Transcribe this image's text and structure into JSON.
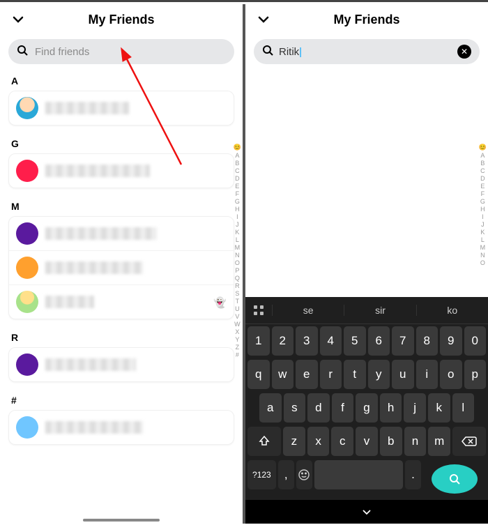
{
  "title": "My Friends",
  "search_placeholder": "Find friends",
  "search_value": "Ritik",
  "sections": {
    "A": "A",
    "G": "G",
    "M": "M",
    "R": "R",
    "hash": "#"
  },
  "avatars": {
    "a1": "#ffb36b",
    "g1": "#ff1e4b",
    "m1": "#5a1a9e",
    "m2": "#ffa02e",
    "m3": "#9ad86a",
    "r1": "#5a1a9e",
    "h1": "#70c6ff"
  },
  "mutual_icon": "👻",
  "az": [
    "😊",
    "A",
    "B",
    "C",
    "D",
    "E",
    "F",
    "G",
    "H",
    "I",
    "J",
    "K",
    "L",
    "M",
    "N",
    "O",
    "P",
    "Q",
    "R",
    "S",
    "T",
    "U",
    "V",
    "W",
    "X",
    "Y",
    "Z",
    "#"
  ],
  "az_right": [
    "😊",
    "A",
    "B",
    "C",
    "D",
    "E",
    "F",
    "G",
    "H",
    "I",
    "J",
    "K",
    "L",
    "M",
    "N",
    "O"
  ],
  "sugg": {
    "s1": "se",
    "s2": "sir",
    "s3": "ko"
  },
  "keys": {
    "n": [
      "1",
      "2",
      "3",
      "4",
      "5",
      "6",
      "7",
      "8",
      "9",
      "0"
    ],
    "q": [
      "q",
      "w",
      "e",
      "r",
      "t",
      "y",
      "u",
      "i",
      "o",
      "p"
    ],
    "a": [
      "a",
      "s",
      "d",
      "f",
      "g",
      "h",
      "j",
      "k",
      "l"
    ],
    "z": [
      "z",
      "x",
      "c",
      "v",
      "b",
      "n",
      "m"
    ],
    "num": "?123",
    "comma": ",",
    "dot": "."
  }
}
